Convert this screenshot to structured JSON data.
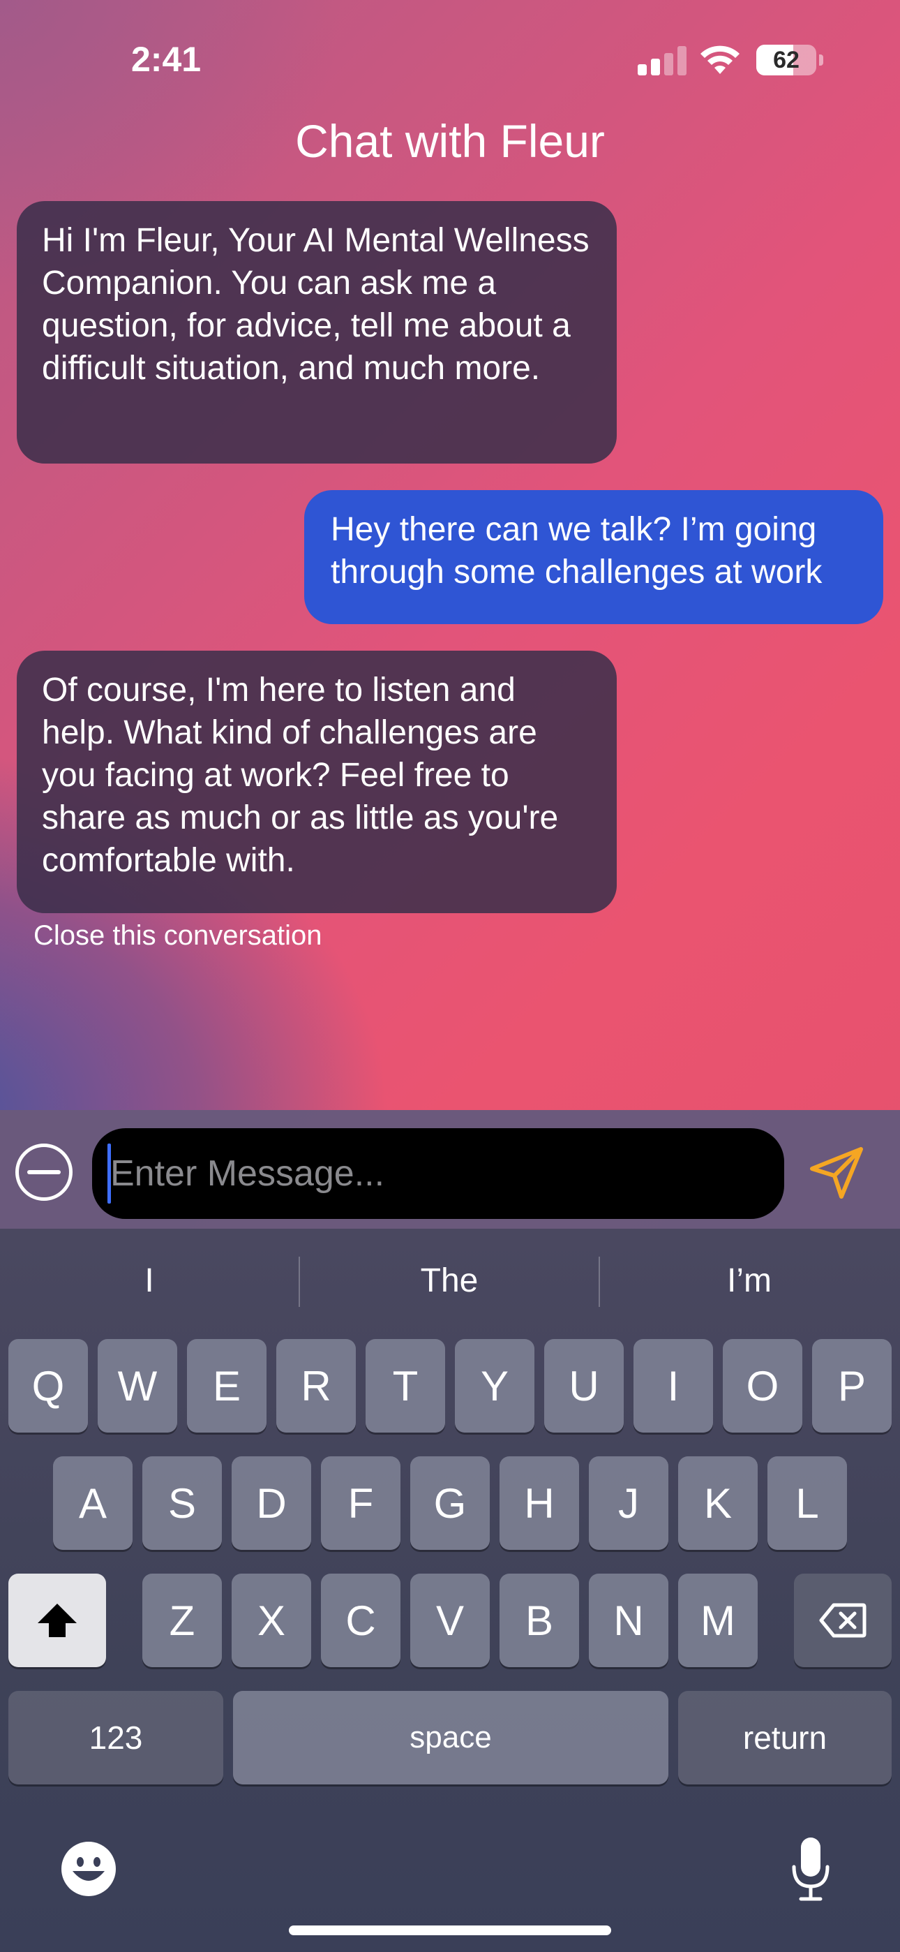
{
  "status_bar": {
    "time": "2:41",
    "battery_level": "62",
    "signal_bars_active": 2,
    "signal_bars_total": 4
  },
  "header": {
    "title": "Chat with Fleur"
  },
  "messages": [
    {
      "sender": "bot",
      "text": "Hi I'm Fleur, Your AI Mental Wellness Companion. You can ask me a question, for advice, tell me about a difficult situation, and much more."
    },
    {
      "sender": "user",
      "text": "Hey there can we talk? I’m going through some challenges at work"
    },
    {
      "sender": "bot",
      "text": "Of course, I'm here to listen and help. What kind of challenges are you facing at work? Feel free to share as much or as little as you're comfortable with."
    }
  ],
  "close_link": "Close this conversation",
  "composer": {
    "placeholder": "Enter Message...",
    "send_icon": "paper-plane-icon",
    "send_color": "#f5a623",
    "minus_icon": "minus-circle-icon"
  },
  "keyboard": {
    "suggestions": [
      "I",
      "The",
      "I’m"
    ],
    "row1": [
      "Q",
      "W",
      "E",
      "R",
      "T",
      "Y",
      "U",
      "I",
      "O",
      "P"
    ],
    "row2": [
      "A",
      "S",
      "D",
      "F",
      "G",
      "H",
      "J",
      "K",
      "L"
    ],
    "row3": [
      "Z",
      "X",
      "C",
      "V",
      "B",
      "N",
      "M"
    ],
    "numbers_label": "123",
    "space_label": "space",
    "return_label": "return"
  },
  "colors": {
    "user_bubble": "#2f55d4",
    "bot_bubble": "#3a2e4a"
  }
}
